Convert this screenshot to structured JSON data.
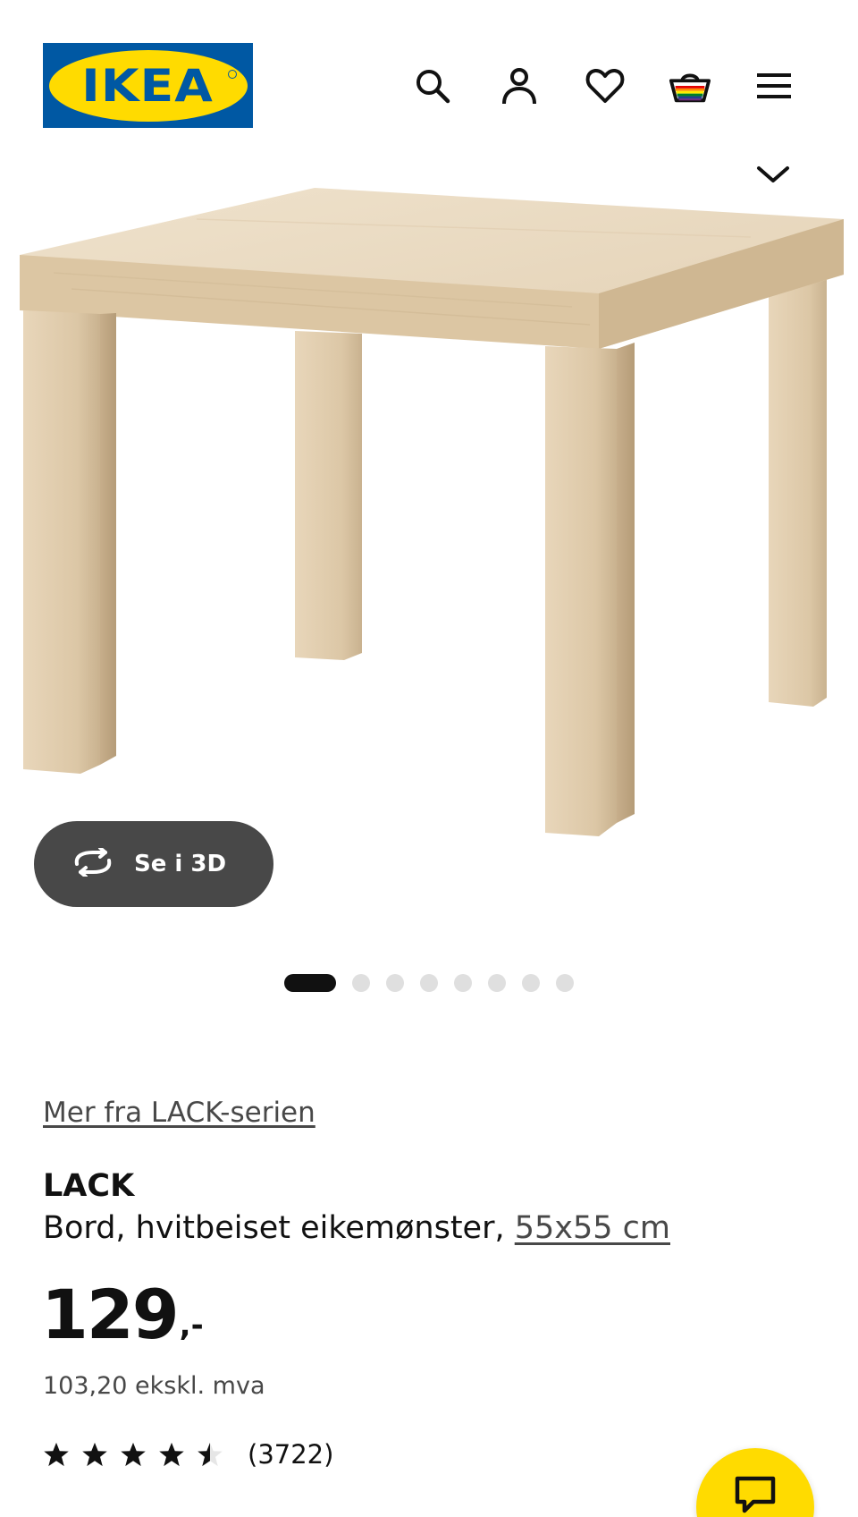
{
  "header": {
    "logo_text": "IKEA",
    "icons": [
      "search-icon",
      "user-icon",
      "heart-icon",
      "basket-icon",
      "menu-icon"
    ]
  },
  "gallery": {
    "view_3d_label": "Se i 3D",
    "image_count": 8,
    "active_image": 1
  },
  "product": {
    "series_link": "Mer fra LACK-serien",
    "name": "LACK",
    "description": "Bord, hvitbeiset eikemønster,",
    "size_link": "55x55 cm",
    "price_integer": "129",
    "price_suffix": ",-",
    "price_ex_vat": "103,20 ekskl. mva",
    "rating_value": 4.5,
    "rating_count": "(3722)"
  },
  "colors": {
    "ikea_blue": "#0058a3",
    "ikea_yellow": "#ffdb00",
    "button_gray": "#484848"
  }
}
